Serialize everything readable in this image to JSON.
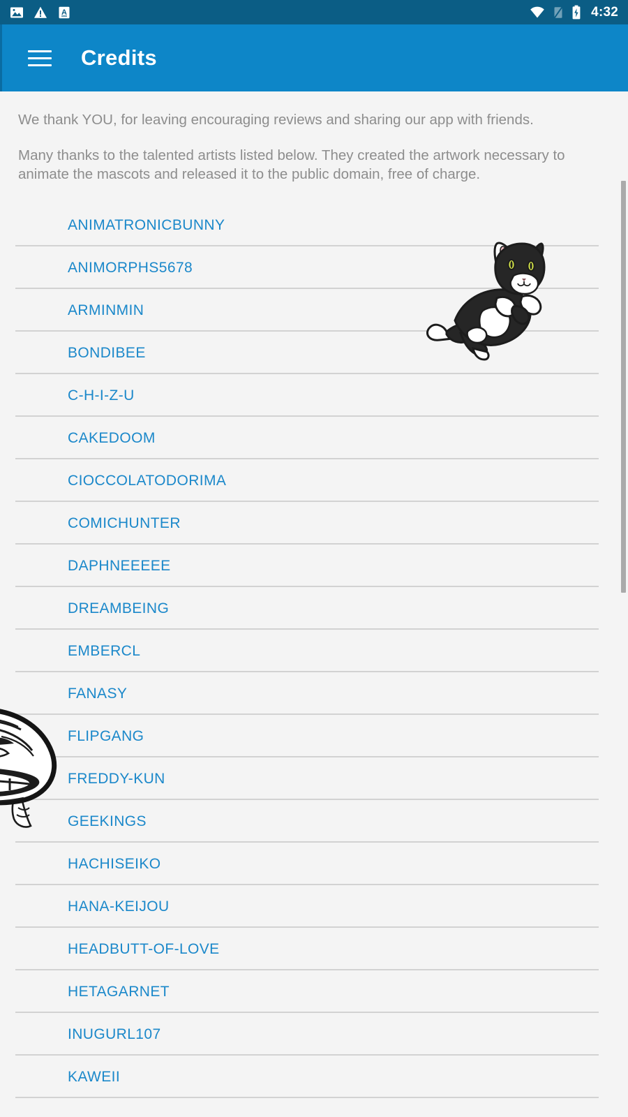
{
  "status_bar": {
    "icons_left": [
      "image-icon",
      "warning-icon",
      "text-a-icon"
    ],
    "icons_right": [
      "wifi-icon",
      "signal-off-icon",
      "battery-charging-icon"
    ],
    "clock": "4:32",
    "background_color": "#0b5d85"
  },
  "toolbar": {
    "menu_icon": "hamburger-menu-icon",
    "title": "Credits",
    "background_color": "#0d86c8",
    "text_color": "#ffffff"
  },
  "content": {
    "intro_paragraph_1": "We thank YOU, for leaving encouraging reviews and sharing our app with friends.",
    "intro_paragraph_2": "Many thanks to the talented artists listed below. They created the artwork necessary to animate the mascots and released it to the public domain, free of charge.",
    "text_color": "#8d8d8d",
    "background_color": "#f4f4f4"
  },
  "credits_list": {
    "link_color": "#1b88ca",
    "divider_color": "#d2d2d2",
    "items": [
      {
        "label": "ANIMATRONICBUNNY"
      },
      {
        "label": "ANIMORPHS5678"
      },
      {
        "label": "ARMINMIN"
      },
      {
        "label": "BONDIBEE"
      },
      {
        "label": "C-H-I-Z-U"
      },
      {
        "label": "CAKEDOOM"
      },
      {
        "label": "CIOCCOLATODORIMA"
      },
      {
        "label": "COMICHUNTER"
      },
      {
        "label": "DAPHNEEEEE"
      },
      {
        "label": "DREAMBEING"
      },
      {
        "label": "EMBERCL"
      },
      {
        "label": "FANASY"
      },
      {
        "label": "FLIPGANG"
      },
      {
        "label": "FREDDY-KUN"
      },
      {
        "label": "GEEKINGS"
      },
      {
        "label": "HACHISEIKO"
      },
      {
        "label": "HANA-KEIJOU"
      },
      {
        "label": "HEADBUTT-OF-LOVE"
      },
      {
        "label": "HETAGARNET"
      },
      {
        "label": "INUGURL107"
      },
      {
        "label": "KAWEII"
      }
    ]
  },
  "scrollbar": {
    "thumb_color": "#aaaaaa"
  },
  "mascots": [
    {
      "name": "cat-mascot"
    },
    {
      "name": "troll-face-mascot"
    }
  ]
}
